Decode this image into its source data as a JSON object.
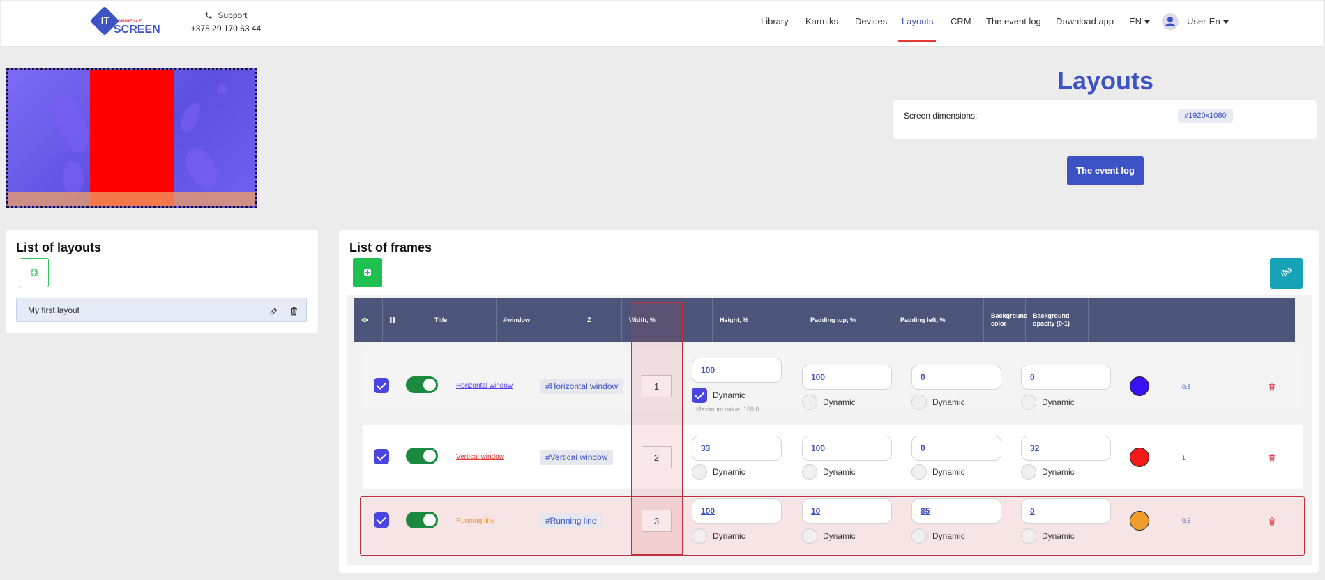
{
  "header": {
    "logo": {
      "it": "IT",
      "ambience": "AMBIENCE",
      "screen": "SCREEN"
    },
    "support": {
      "label": "Support",
      "phone": "+375 29 170 63 44"
    },
    "nav": [
      "Library",
      "Karmiks",
      "Devices",
      "Layouts",
      "CRM",
      "The event log",
      "Download app"
    ],
    "active_nav": "Layouts",
    "lang": "EN",
    "user": "User-En"
  },
  "page": {
    "title": "Layouts",
    "screen_dimensions_label": "Screen dimensions:",
    "screen_dimensions_value": "#1920x1080",
    "event_log_button": "The event log"
  },
  "layouts": {
    "title": "List of layouts",
    "items": [
      {
        "name": "My first layout"
      }
    ]
  },
  "frames": {
    "title": "List of frames",
    "columns": [
      "Title",
      "#window",
      "Z",
      "Width, %",
      "Height, %",
      "Padding top, %",
      "Padding left, %",
      "Background color",
      "Background opacity (0-1)"
    ],
    "dynamic_label": "Dynamic",
    "rows": [
      {
        "title": "Horizontal window",
        "title_color": "#5a3cf0",
        "window": "#Horizontal window",
        "z": "1",
        "width": "100",
        "width_dynamic": true,
        "width_note": "Maximum value: 100.0",
        "height": "100",
        "padding_top": "0",
        "padding_left": "0",
        "bg_color": "#3b10f2",
        "opacity": "0.5"
      },
      {
        "title": "Vertical window",
        "title_color": "#e53935",
        "window": "#Vertical window",
        "z": "2",
        "width": "33",
        "width_dynamic": false,
        "width_note": "",
        "height": "100",
        "padding_top": "0",
        "padding_left": "32",
        "bg_color": "#f41818",
        "opacity": "1"
      },
      {
        "title": "Running line",
        "title_color": "#f0962d",
        "window": "#Running line",
        "z": "3",
        "width": "100",
        "width_dynamic": false,
        "width_note": "",
        "height": "10",
        "padding_top": "85",
        "padding_left": "0",
        "bg_color": "#f39c2e",
        "opacity": "0.5"
      }
    ]
  },
  "icons": [
    "phone-icon",
    "eye-icon",
    "pause-icon",
    "edit-icon",
    "trash-icon",
    "gear-icon",
    "plus-icon",
    "user-icon"
  ]
}
